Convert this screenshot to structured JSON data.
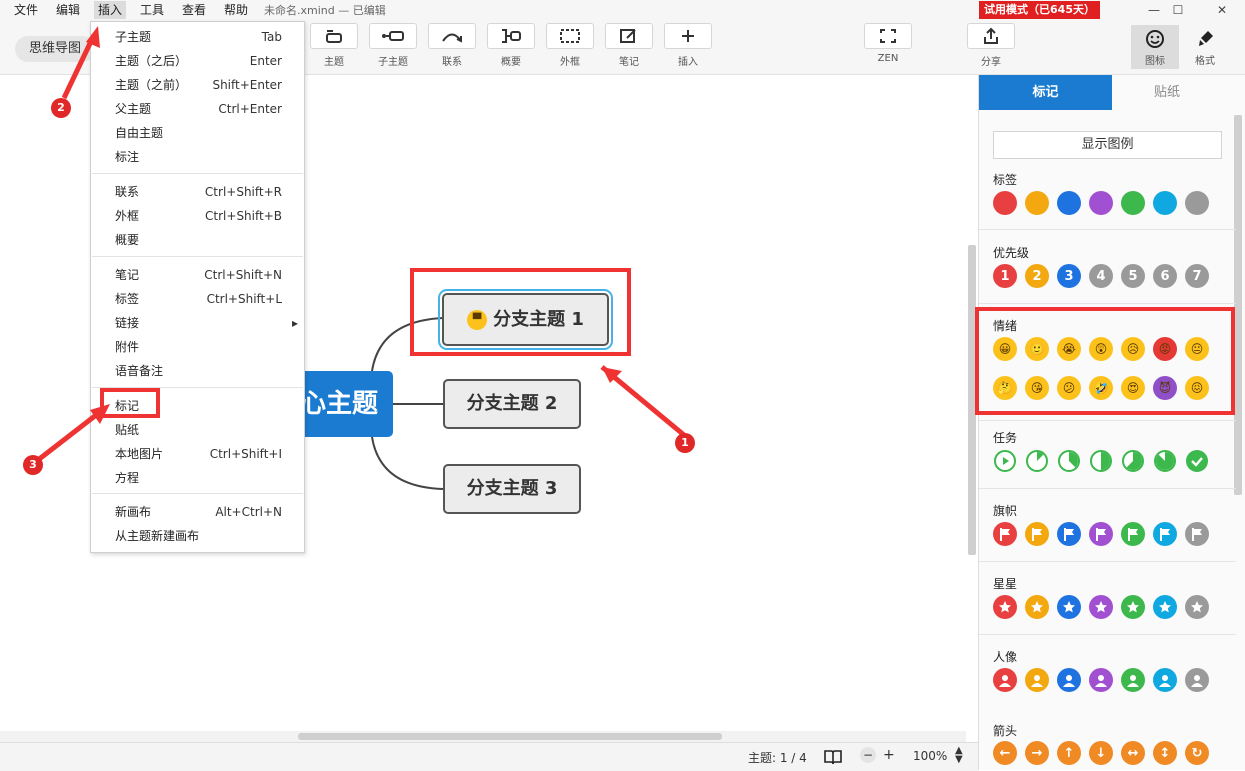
{
  "menubar": {
    "items": [
      "文件",
      "编辑",
      "插入",
      "工具",
      "查看",
      "帮助"
    ],
    "filename": "未命名.xmind — 已编辑",
    "trial": "试用模式（已645天）",
    "window_controls": [
      "—",
      "☐",
      "✕"
    ]
  },
  "toolbar": {
    "mindmap_label": "思维导图",
    "buttons": [
      "主题",
      "子主题",
      "联系",
      "概要",
      "外框",
      "笔记",
      "插入"
    ],
    "zen": "ZEN",
    "share": "分享",
    "icon_tab": "图标",
    "format_tab": "格式"
  },
  "menu": {
    "items": [
      {
        "label": "子主题",
        "shortcut": "Tab"
      },
      {
        "label": "主题（之后）",
        "shortcut": "Enter"
      },
      {
        "label": "主题（之前）",
        "shortcut": "Shift+Enter"
      },
      {
        "label": "父主题",
        "shortcut": "Ctrl+Enter"
      },
      {
        "label": "自由主题",
        "shortcut": ""
      },
      {
        "label": "标注",
        "shortcut": ""
      },
      {
        "label": "联系",
        "shortcut": "Ctrl+Shift+R"
      },
      {
        "label": "外框",
        "shortcut": "Ctrl+Shift+B"
      },
      {
        "label": "概要",
        "shortcut": ""
      },
      {
        "label": "笔记",
        "shortcut": "Ctrl+Shift+N"
      },
      {
        "label": "标签",
        "shortcut": "Ctrl+Shift+L"
      },
      {
        "label": "链接",
        "shortcut": "▸"
      },
      {
        "label": "附件",
        "shortcut": ""
      },
      {
        "label": "语音备注",
        "shortcut": ""
      },
      {
        "label": "标记",
        "shortcut": ""
      },
      {
        "label": "贴纸",
        "shortcut": ""
      },
      {
        "label": "本地图片",
        "shortcut": "Ctrl+Shift+I"
      },
      {
        "label": "方程",
        "shortcut": ""
      },
      {
        "label": "新画布",
        "shortcut": "Alt+Ctrl+N"
      },
      {
        "label": "从主题新建画布",
        "shortcut": ""
      }
    ]
  },
  "map": {
    "central": "心主题",
    "branches": [
      "分支主题 1",
      "分支主题 2",
      "分支主题 3"
    ],
    "markers": [
      "1",
      "2",
      "3"
    ]
  },
  "status": {
    "topics": "主题: 1 / 4",
    "zoom": "100%",
    "minus": "−",
    "plus": "+"
  },
  "panel": {
    "tabs": [
      "标记",
      "贴纸"
    ],
    "show_legend": "显示图例",
    "sections": [
      "标签",
      "优先级",
      "情绪",
      "任务",
      "旗帜",
      "星星",
      "人像",
      "箭头"
    ],
    "tag_colors": [
      "#e84040",
      "#f4a80f",
      "#1f73e0",
      "#a050d0",
      "#3cb84c",
      "#10a8e0",
      "#9a9a9a"
    ],
    "priority": [
      "1",
      "2",
      "3",
      "4",
      "5",
      "6",
      "7"
    ],
    "priority_colors": [
      "#e84040",
      "#f4a80f",
      "#1f73e0",
      "#9a9a9a",
      "#9a9a9a",
      "#9a9a9a",
      "#9a9a9a"
    ],
    "emotions_row1": [
      "😀",
      "🙂",
      "😭",
      "😲",
      "😥",
      "😡",
      "😐"
    ],
    "emotions_row2": [
      "🤔",
      "😘",
      "😕",
      "🤣",
      "😍",
      "😈",
      "😖"
    ],
    "arrows": [
      "←",
      "→",
      "↑",
      "↓",
      "↔",
      "↕",
      "↻"
    ]
  }
}
